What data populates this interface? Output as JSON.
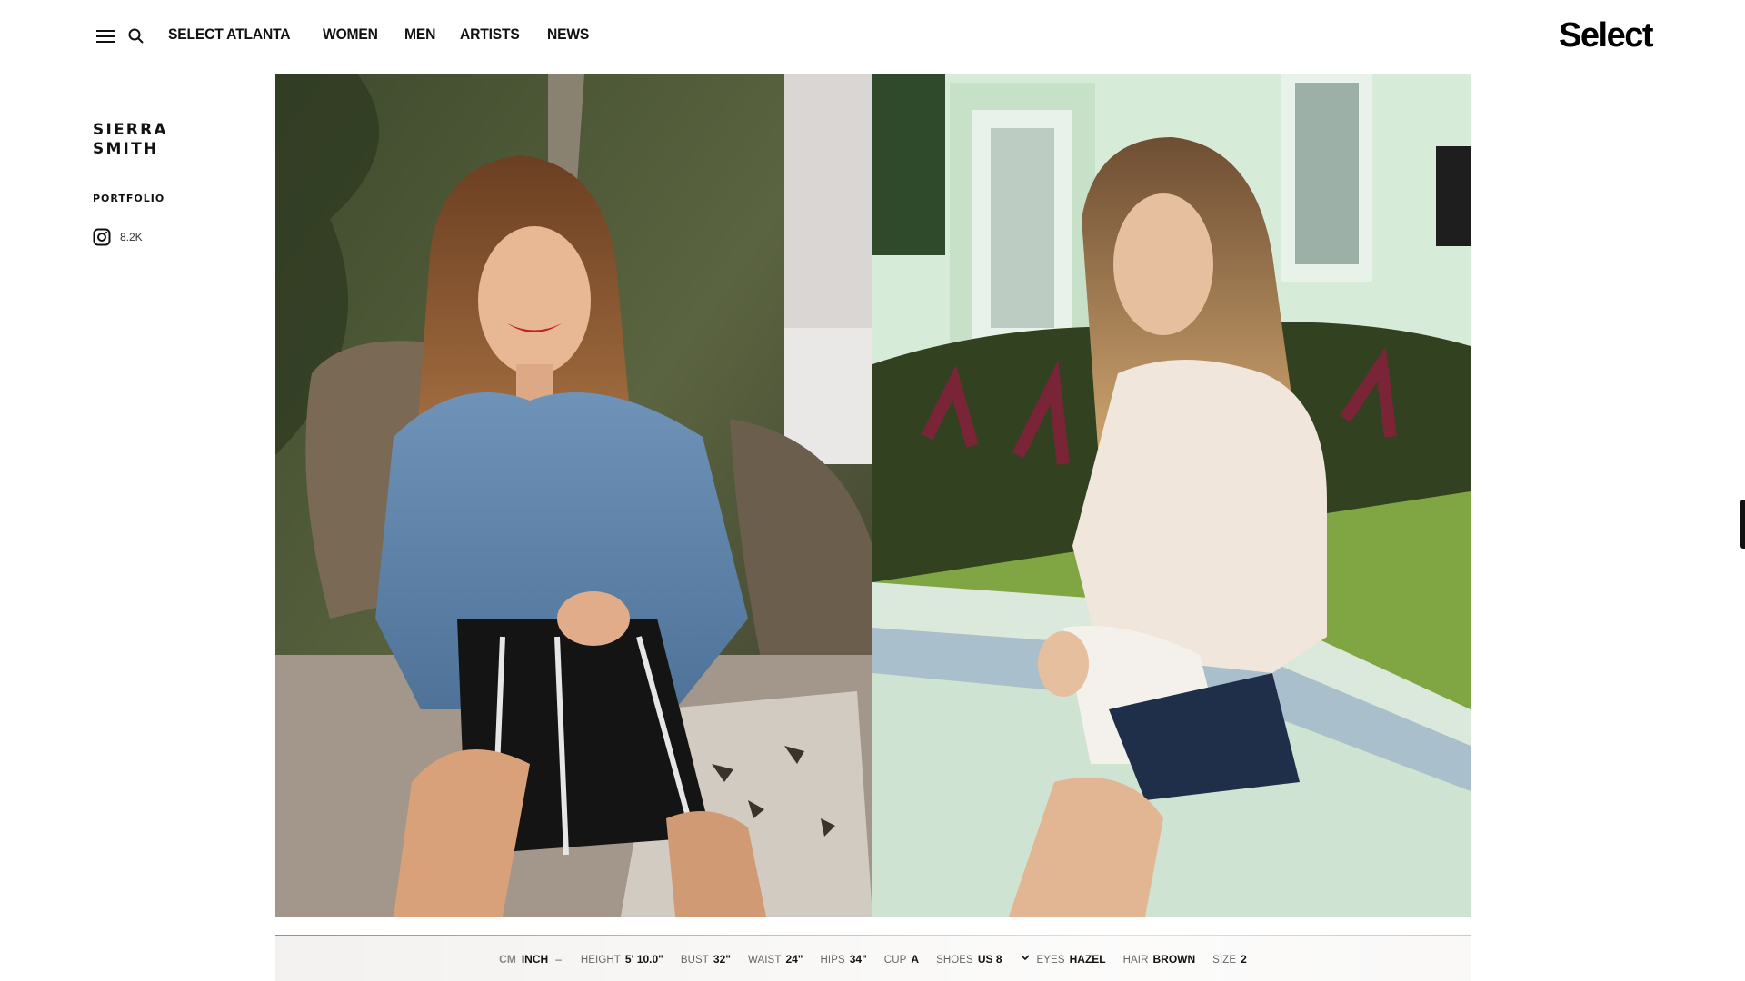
{
  "header": {
    "nav": [
      "SELECT ATLANTA",
      "WOMEN",
      "MEN",
      "ARTISTS",
      "NEWS"
    ],
    "logo": "Select",
    "menu_icon": "hamburger-icon",
    "search_icon": "search-icon"
  },
  "sidebar": {
    "name_line1": "SIERRA",
    "name_line2": "SMITH",
    "portfolio": "PORTFOLIO",
    "instagram_count": "8.2K",
    "instagram_icon": "instagram-icon"
  },
  "stats": {
    "unit_cm": "CM",
    "unit_inch": "INCH",
    "separator": "–",
    "items": [
      {
        "label": "HEIGHT",
        "value": "5' 10.0\""
      },
      {
        "label": "BUST",
        "value": "32\""
      },
      {
        "label": "WAIST",
        "value": "24\""
      },
      {
        "label": "HIPS",
        "value": "34\""
      },
      {
        "label": "CUP",
        "value": "A"
      },
      {
        "label": "SHOES",
        "value": "US 8"
      },
      {
        "label": "EYES",
        "value": "HAZEL"
      },
      {
        "label": "HAIR",
        "value": "BROWN"
      },
      {
        "label": "SIZE",
        "value": "2"
      }
    ],
    "chevron_icon": "chevron-down-icon"
  },
  "colors": {
    "text": "#111111",
    "background": "#ffffff"
  }
}
